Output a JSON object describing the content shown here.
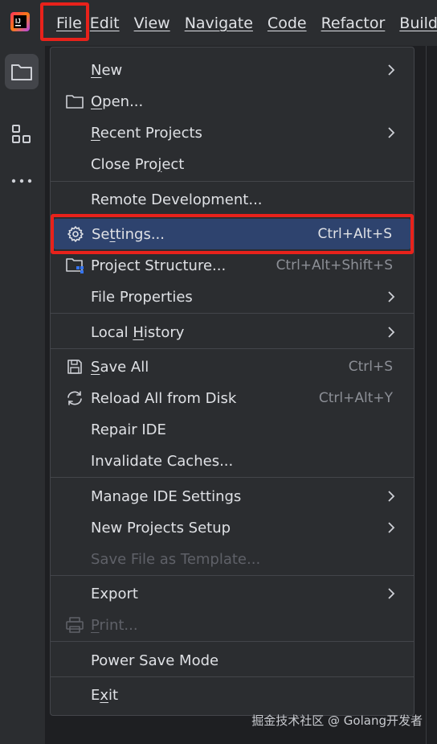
{
  "menubar": {
    "items": [
      {
        "label": "File",
        "mnemonic": "F",
        "rest": "ile"
      },
      {
        "label": "Edit",
        "mnemonic": "E",
        "rest": "dit"
      },
      {
        "label": "View",
        "mnemonic": "V",
        "rest": "iew"
      },
      {
        "label": "Navigate",
        "mnemonic": "N",
        "rest": "avigate"
      },
      {
        "label": "Code",
        "mnemonic": "C",
        "rest": "ode"
      },
      {
        "label": "Refactor",
        "mnemonic": "R",
        "rest": "efactor"
      },
      {
        "label": "Build",
        "mnemonic": "B",
        "rest": "uild"
      }
    ]
  },
  "toolstrip": {
    "items": [
      {
        "icon": "folder-icon",
        "active": true
      },
      {
        "icon": "structure-icon",
        "active": false
      },
      {
        "icon": "more-icon",
        "active": false
      }
    ]
  },
  "file_menu": {
    "new": {
      "pre": "",
      "mnemonic": "N",
      "post": "ew",
      "submenu": true
    },
    "open": {
      "pre": "",
      "mnemonic": "O",
      "post": "pen...",
      "icon": "folder-open-icon"
    },
    "recent_projects": {
      "pre": "",
      "mnemonic": "R",
      "post": "ecent Projects",
      "submenu": true
    },
    "close_project": {
      "pre": "Close Pro",
      "mnemonic": "j",
      "post": "ect"
    },
    "remote_development": {
      "label": "Remote Development..."
    },
    "settings": {
      "pre": "Se",
      "mnemonic": "t",
      "post": "tings...",
      "shortcut": "Ctrl+Alt+S",
      "icon": "gear-icon"
    },
    "project_structure": {
      "label": "Project Structure...",
      "shortcut": "Ctrl+Alt+Shift+S",
      "icon": "project-structure-icon"
    },
    "file_properties": {
      "label": "File Properties",
      "submenu": true
    },
    "local_history": {
      "pre": "Local ",
      "mnemonic": "H",
      "post": "istory",
      "submenu": true
    },
    "save_all": {
      "pre": "",
      "mnemonic": "S",
      "post": "ave All",
      "shortcut": "Ctrl+S",
      "icon": "save-icon"
    },
    "reload_all": {
      "label": "Reload All from Disk",
      "shortcut": "Ctrl+Alt+Y",
      "icon": "reload-icon"
    },
    "repair_ide": {
      "label": "Repair IDE"
    },
    "invalidate_caches": {
      "label": "Invalidate Caches..."
    },
    "manage_ide_settings": {
      "label": "Manage IDE Settings",
      "submenu": true
    },
    "new_projects_setup": {
      "label": "New Projects Setup",
      "submenu": true
    },
    "save_file_as_template": {
      "label": "Save File as Template...",
      "disabled": true
    },
    "export": {
      "label": "Export",
      "submenu": true
    },
    "print": {
      "pre": "",
      "mnemonic": "P",
      "post": "rint...",
      "disabled": true,
      "icon": "print-icon"
    },
    "power_save_mode": {
      "label": "Power Save Mode"
    },
    "exit": {
      "pre": "E",
      "mnemonic": "x",
      "post": "it"
    }
  },
  "colors": {
    "highlight_border": "#e8221b",
    "selected_item_bg": "#2e436e",
    "menu_bg": "#2b2d30",
    "text": "#dfe1e5",
    "shortcut_text": "#8c8f96",
    "disabled_text": "#5f6168"
  },
  "watermark": "掘金技术社区 @ Golang开发者"
}
